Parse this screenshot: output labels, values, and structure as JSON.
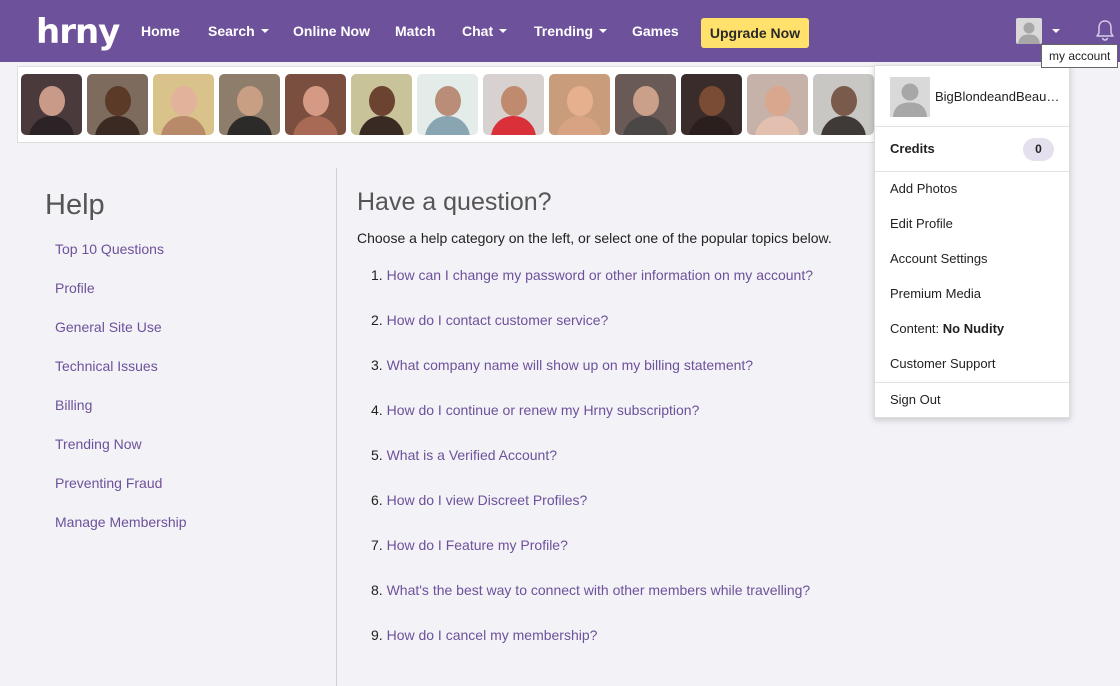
{
  "nav": {
    "logo": "hrny",
    "items": [
      "Home",
      "Search",
      "Online Now",
      "Match",
      "Chat",
      "Trending",
      "Games"
    ],
    "upgrade_label": "Upgrade Now",
    "account_tooltip": "my account"
  },
  "sidebar": {
    "title": "Help",
    "links": [
      "Top 10 Questions",
      "Profile",
      "General Site Use",
      "Technical Issues",
      "Billing",
      "Trending Now",
      "Preventing Fraud",
      "Manage Membership"
    ]
  },
  "main": {
    "title": "Have a question?",
    "subtitle": "Choose a help category on the left, or select one of the popular topics below.",
    "questions": [
      {
        "num": "1.",
        "text": "How can I change my password or other information on my account?"
      },
      {
        "num": "2.",
        "text": "How do I contact customer service?"
      },
      {
        "num": "3.",
        "text": "What company name will show up on my billing statement?"
      },
      {
        "num": "4.",
        "text": "How do I continue or renew my Hrny subscription?"
      },
      {
        "num": "5.",
        "text": "What is a Verified Account?"
      },
      {
        "num": "6.",
        "text": "How do I view Discreet Profiles?"
      },
      {
        "num": "7.",
        "text": "How do I Feature my Profile?"
      },
      {
        "num": "8.",
        "text": "What's the best way to connect with other members while travelling?"
      },
      {
        "num": "9.",
        "text": "How do I cancel my membership?"
      }
    ]
  },
  "account_menu": {
    "username": "BigBlondeandBeautiful",
    "credits_label": "Credits",
    "credits_value": "0",
    "items": [
      "Add Photos",
      "Edit Profile",
      "Account Settings",
      "Premium Media"
    ],
    "content_label": "Content:",
    "content_value": "No Nudity",
    "support": "Customer Support",
    "sign_out": "Sign Out"
  },
  "colors": {
    "brand": "#6e519b",
    "upgrade": "#ffe16b",
    "background": "#f2f2f7",
    "link": "#6e519b"
  },
  "icons": [
    "user-silhouette-icon",
    "chevron-down-icon",
    "bell-icon"
  ]
}
